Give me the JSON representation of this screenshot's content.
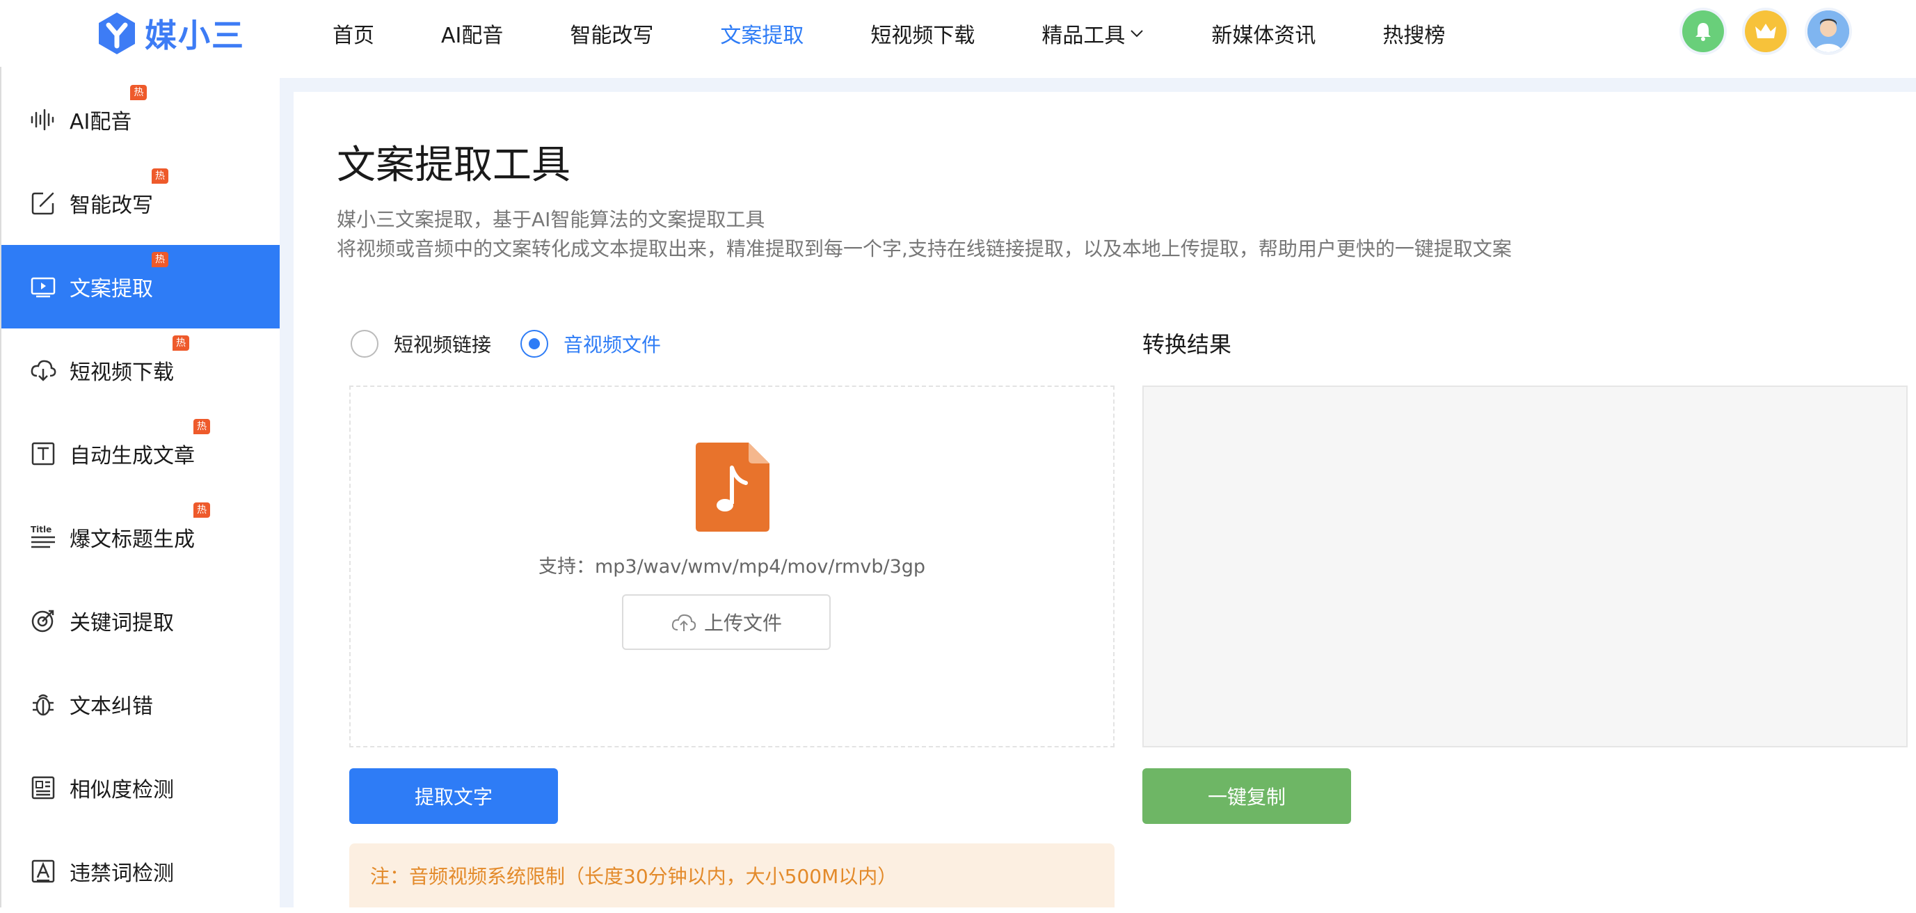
{
  "brand": {
    "name": "媒小三",
    "accent": "#2e7cf6"
  },
  "nav": {
    "items": [
      {
        "label": "首页"
      },
      {
        "label": "AI配音"
      },
      {
        "label": "智能改写"
      },
      {
        "label": "文案提取",
        "active": true
      },
      {
        "label": "短视频下载"
      },
      {
        "label": "精品工具",
        "dropdown": true
      },
      {
        "label": "新媒体资讯"
      },
      {
        "label": "热搜榜"
      }
    ]
  },
  "header_icons": [
    "bell-icon",
    "crown-icon",
    "avatar"
  ],
  "sidebar": {
    "hot_badge": "热",
    "items": [
      {
        "label": "AI配音",
        "icon": "waveform-icon",
        "hot": true
      },
      {
        "label": "智能改写",
        "icon": "edit-icon",
        "hot": true
      },
      {
        "label": "文案提取",
        "icon": "video-icon",
        "hot": true,
        "active": true
      },
      {
        "label": "短视频下载",
        "icon": "cloud-download-icon",
        "hot": true
      },
      {
        "label": "自动生成文章",
        "icon": "text-box-icon",
        "hot": true
      },
      {
        "label": "爆文标题生成",
        "icon": "title-icon",
        "hot": true
      },
      {
        "label": "关键词提取",
        "icon": "target-icon",
        "hot": false
      },
      {
        "label": "文本纠错",
        "icon": "bug-icon",
        "hot": false
      },
      {
        "label": "相似度检测",
        "icon": "document-compare-icon",
        "hot": false
      },
      {
        "label": "违禁词检测",
        "icon": "letter-a-icon",
        "hot": false
      }
    ]
  },
  "main": {
    "title": "文案提取工具",
    "desc_line1": "媒小三文案提取，基于AI智能算法的文案提取工具",
    "desc_line2": "将视频或音频中的文案转化成文本提取出来，精准提取到每一个字,支持在线链接提取，以及本地上传提取，帮助用户更快的一键提取文案",
    "source_options": [
      {
        "label": "短视频链接",
        "checked": false
      },
      {
        "label": "音视频文件",
        "checked": true
      }
    ],
    "support_text": "支持：mp3/wav/wmv/mp4/mov/rmvb/3gp",
    "upload_label": "上传文件",
    "result_title": "转换结果",
    "extract_button": "提取文字",
    "copy_button": "一键复制",
    "note": "注：音频视频系统限制（长度30分钟以内，大小500M以内）"
  }
}
